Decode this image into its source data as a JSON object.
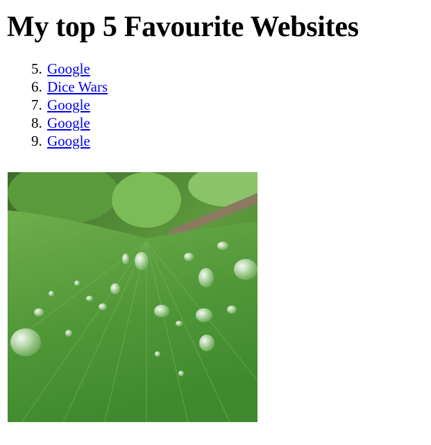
{
  "page": {
    "heading": "My top 5 Favourite Websites"
  },
  "sites": [
    {
      "number": "5.",
      "label": "Google"
    },
    {
      "number": "6.",
      "label": "Dice Wars"
    },
    {
      "number": "7.",
      "label": "Google"
    },
    {
      "number": "8.",
      "label": "Google"
    },
    {
      "number": "9.",
      "label": "Google"
    }
  ],
  "colors": {
    "link": "#0000ee",
    "text": "#000000",
    "background": "#ffffff",
    "leaf": "#4d8a36"
  }
}
